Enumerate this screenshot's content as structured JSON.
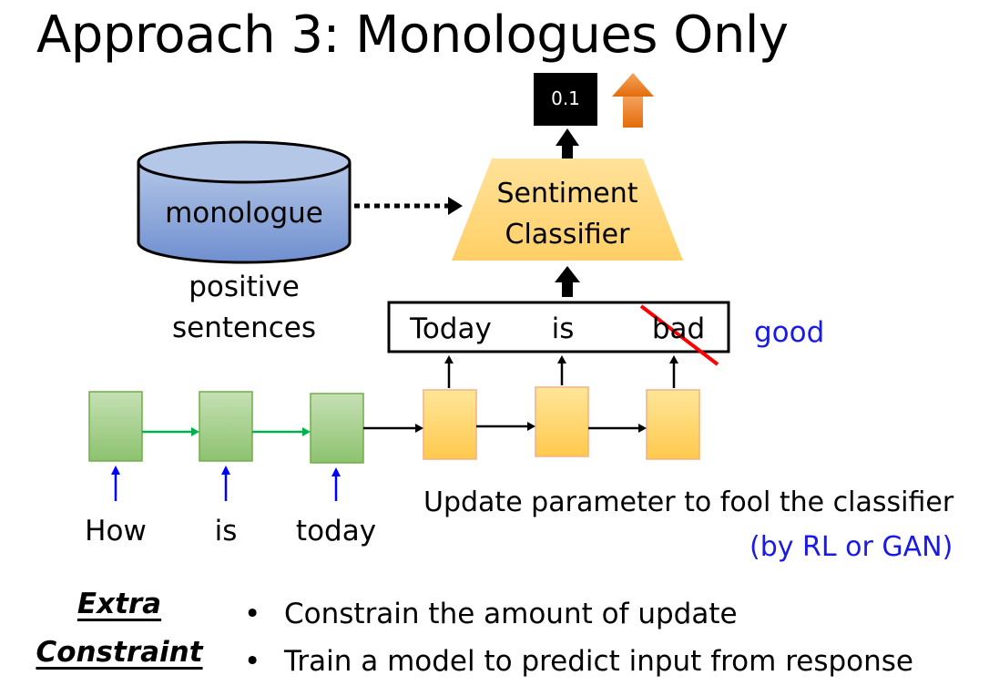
{
  "title": "Approach 3: Monologues Only",
  "score": "0.1",
  "classifier": {
    "line1": "Sentiment",
    "line2": "Classifier"
  },
  "database": {
    "label": "monologue"
  },
  "positive_caption": {
    "line1": "positive",
    "line2": "sentences"
  },
  "response_words": [
    "Today",
    "is",
    "bad"
  ],
  "replacement_word": "good",
  "input_words": [
    "How",
    "is",
    "today"
  ],
  "update_note": {
    "line1": "Update parameter to fool the classifier",
    "line2": "(by RL or GAN)"
  },
  "extra_constraint": {
    "line1": "Extra",
    "line2": "Constraint"
  },
  "bullets": [
    "Constrain the amount of update",
    "Train a model to predict input from response"
  ],
  "colors": {
    "encoder_fill": "#a9d18e",
    "encoder_stroke": "#70ad47",
    "decoder_fill": "#ffd966",
    "decoder_stroke": "#f4b183",
    "db_fill": "#8faadc",
    "classifier_fill": "#ffd47a",
    "orange_arrow": "#ed7d31",
    "blue_text": "#1a1ae6",
    "strike_red": "#ff0000"
  }
}
